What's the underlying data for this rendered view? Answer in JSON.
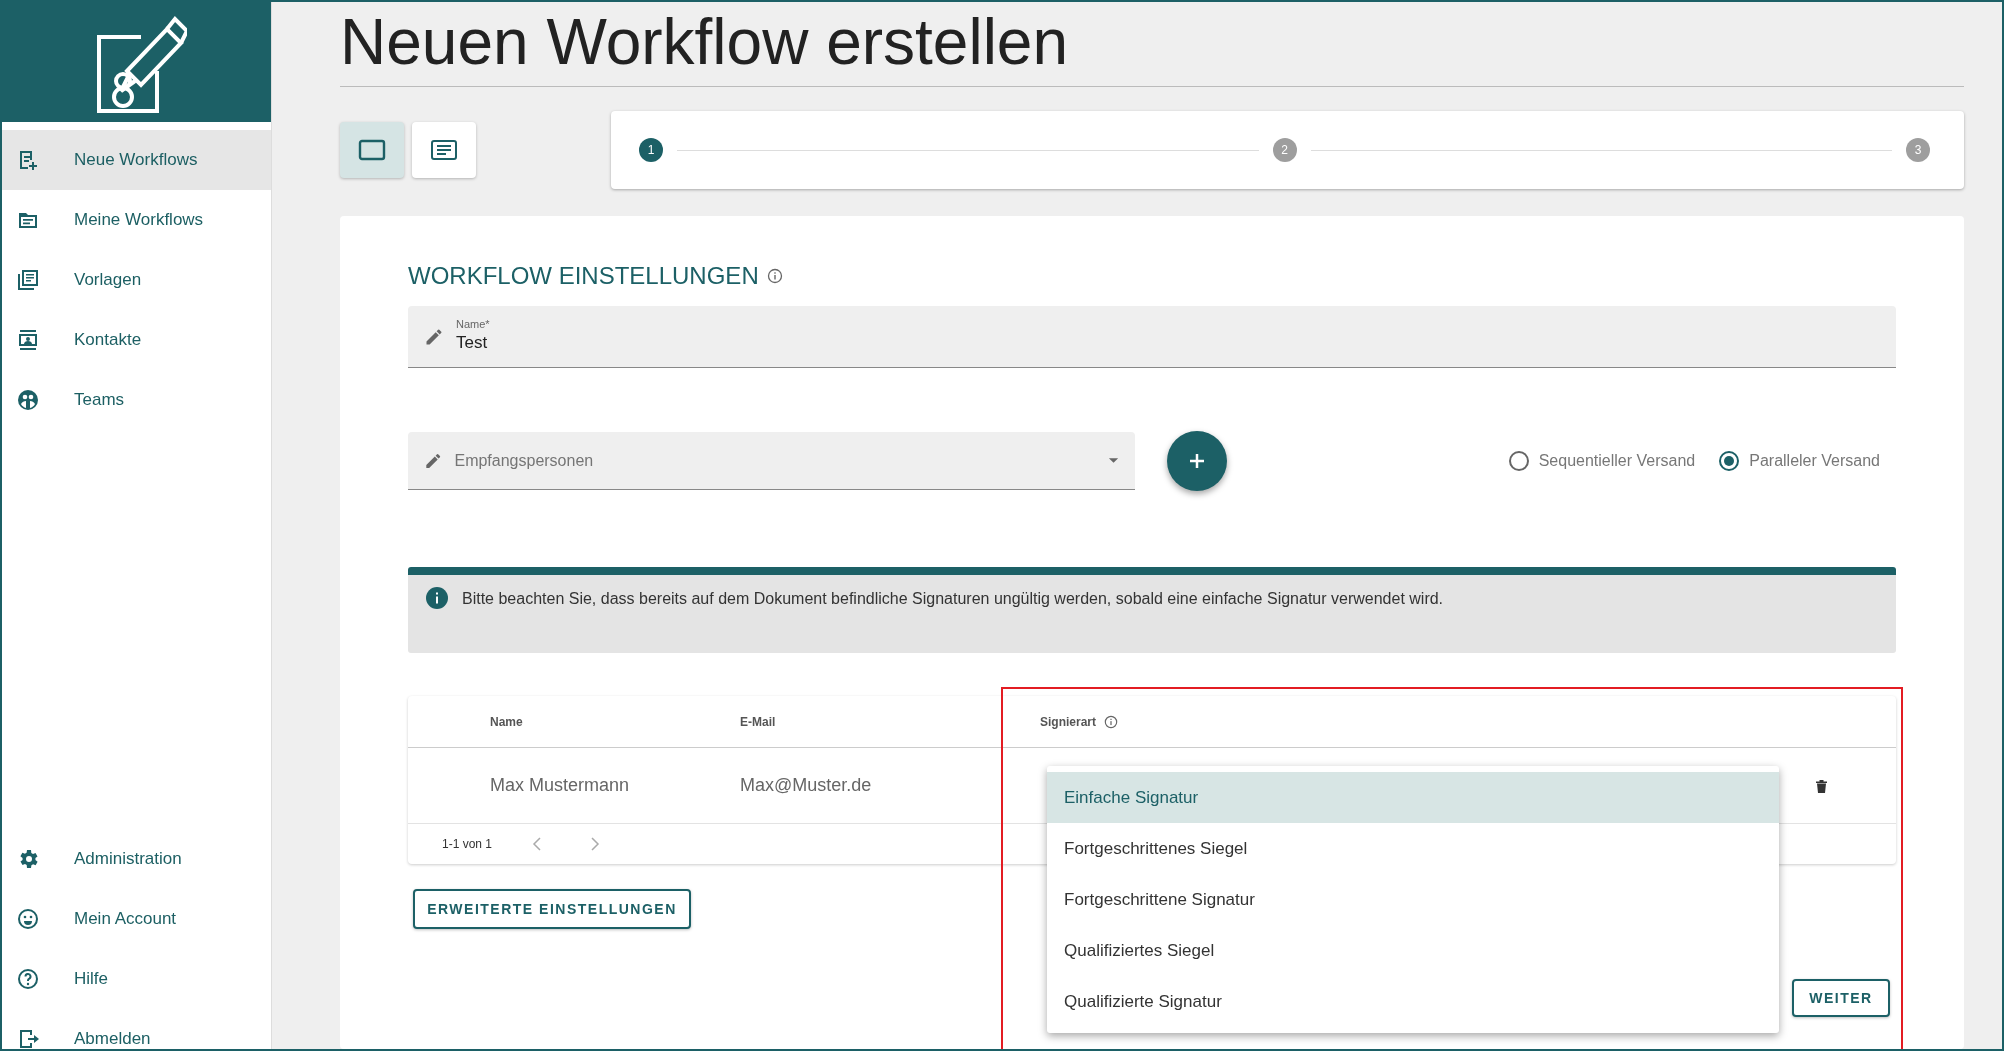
{
  "sidebar": {
    "items": [
      {
        "label": "Neue Workflows",
        "selected": true
      },
      {
        "label": "Meine Workflows",
        "selected": false
      },
      {
        "label": "Vorlagen",
        "selected": false
      },
      {
        "label": "Kontakte",
        "selected": false
      },
      {
        "label": "Teams",
        "selected": false
      }
    ],
    "bottom_items": [
      {
        "label": "Administration",
        "selected": false
      },
      {
        "label": "Mein Account",
        "selected": false
      },
      {
        "label": "Hilfe",
        "selected": false
      },
      {
        "label": "Abmelden",
        "selected": false
      }
    ]
  },
  "title": "Neuen Workflow erstellen",
  "view_toggle": [
    {
      "selected": true
    },
    {
      "selected": false
    }
  ],
  "steps": [
    {
      "number": "1",
      "active": true
    },
    {
      "number": "2",
      "active": false
    },
    {
      "number": "3",
      "active": false
    }
  ],
  "section_title": "WORKFLOW EINSTELLUNGEN",
  "name_field": {
    "label": "Name*",
    "value": "Test"
  },
  "recipients_field": {
    "placeholder": "Empfangspersonen"
  },
  "dispatch_options": [
    {
      "label": "Sequentieller Versand",
      "selected": false
    },
    {
      "label": "Paralleler Versand",
      "selected": true
    }
  ],
  "alert": "Bitte beachten Sie, dass bereits auf dem Dokument befindliche Signaturen ungültig werden, sobald eine einfache Signatur verwendet wird.",
  "table": {
    "columns": [
      "Name",
      "E-Mail",
      "Signierart"
    ],
    "rows": [
      {
        "name": "Max Mustermann",
        "email": "Max@Muster.de"
      }
    ],
    "pagination": "1-1 von 1"
  },
  "signature_dropdown": {
    "options": [
      {
        "label": "Einfache Signatur",
        "selected": true
      },
      {
        "label": "Fortgeschrittenes Siegel",
        "selected": false
      },
      {
        "label": "Fortgeschrittene Signatur",
        "selected": false
      },
      {
        "label": "Qualifiziertes Siegel",
        "selected": false
      },
      {
        "label": "Qualifizierte Signatur",
        "selected": false
      }
    ]
  },
  "advanced_button": "ERWEITERTE EINSTELLUNGEN",
  "next_button": "WEITER"
}
